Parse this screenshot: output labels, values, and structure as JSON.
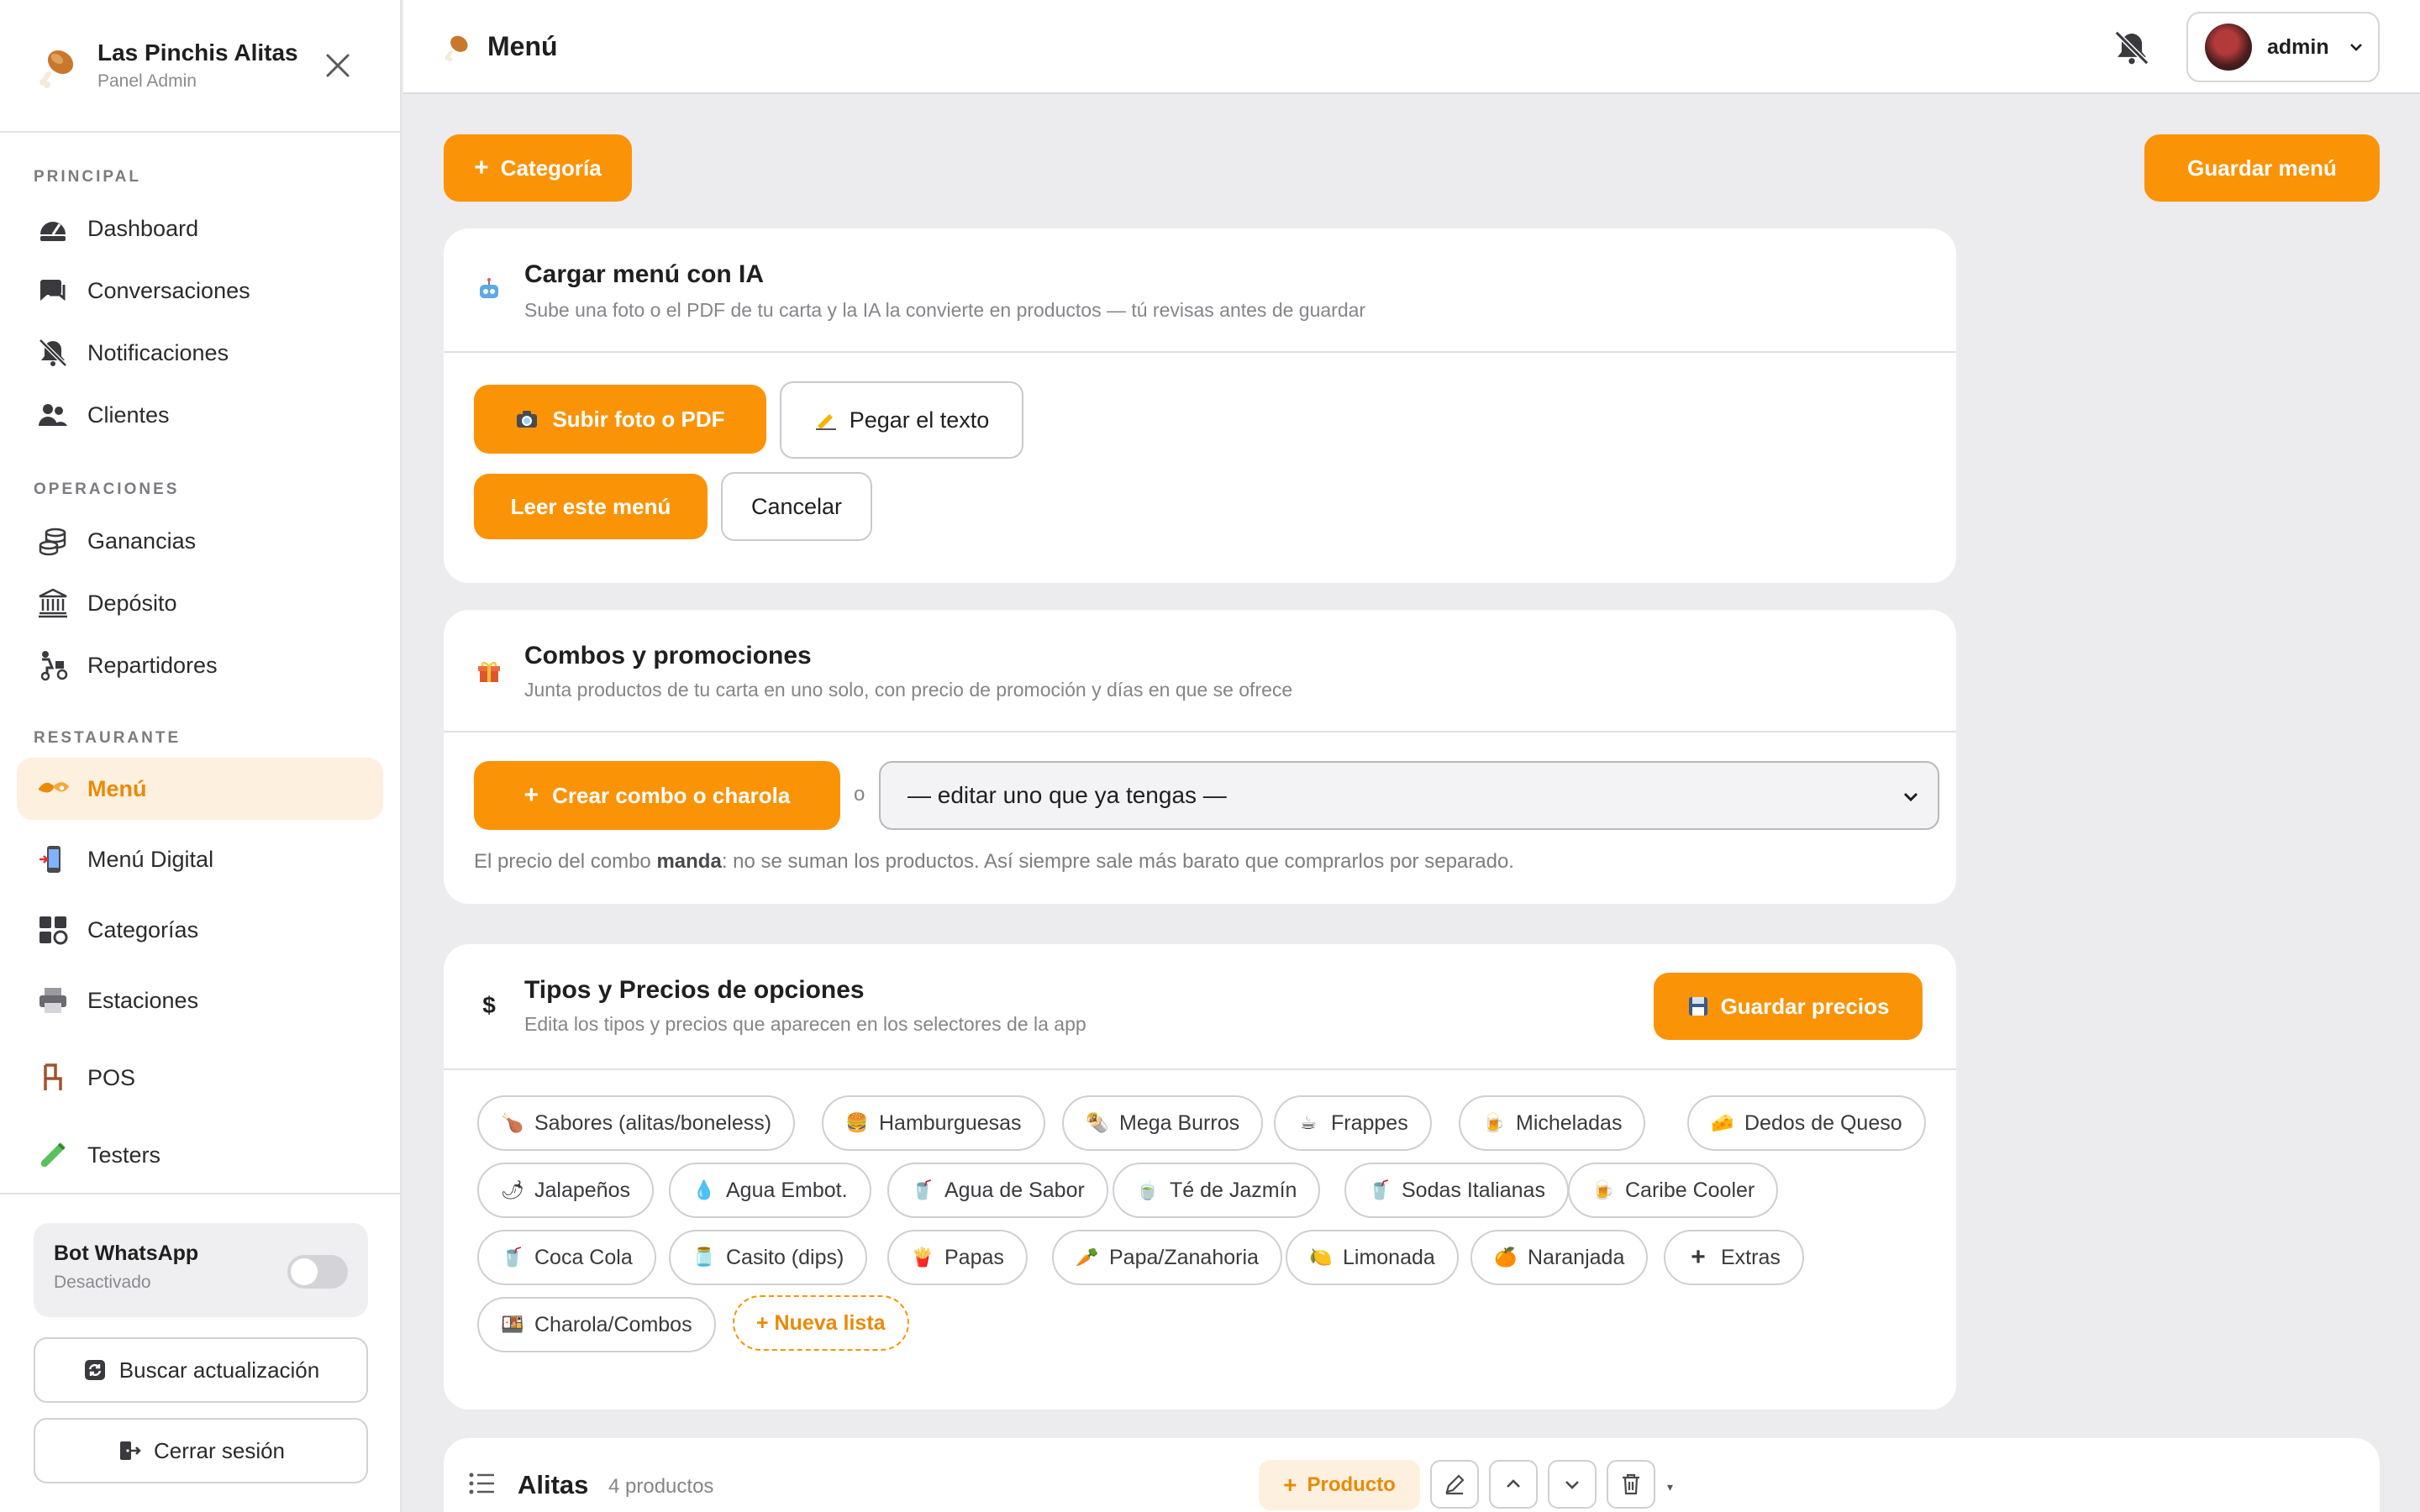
{
  "brand": {
    "title": "Las Pinchis Alitas",
    "subtitle": "Panel Admin",
    "icon": "drumstick-icon"
  },
  "sidebar": {
    "sections": [
      {
        "label": "PRINCIPAL",
        "items": [
          {
            "label": "Dashboard",
            "icon": "dashboard-icon",
            "active": false
          },
          {
            "label": "Conversaciones",
            "icon": "chat-icon",
            "active": false
          },
          {
            "label": "Notificaciones",
            "icon": "bell-off-icon",
            "active": false
          },
          {
            "label": "Clientes",
            "icon": "users-icon",
            "active": false
          }
        ]
      },
      {
        "label": "OPERACIONES",
        "items": [
          {
            "label": "Ganancias",
            "icon": "coins-icon",
            "active": false
          },
          {
            "label": "Depósito",
            "icon": "bank-icon",
            "active": false
          },
          {
            "label": "Repartidores",
            "icon": "delivery-icon",
            "active": false
          }
        ]
      },
      {
        "label": "RESTAURANTE",
        "items": [
          {
            "label": "Menú",
            "icon": "wings-icon",
            "active": true
          },
          {
            "label": "Menú Digital",
            "icon": "phone-icon",
            "active": false
          },
          {
            "label": "Categorías",
            "icon": "grid-icon",
            "active": false
          },
          {
            "label": "Estaciones",
            "icon": "printer-icon",
            "active": false
          },
          {
            "label": "POS",
            "icon": "chair-icon",
            "active": false
          },
          {
            "label": "Testers",
            "icon": "test-tube-icon",
            "active": false
          }
        ]
      }
    ],
    "bot": {
      "title": "Bot WhatsApp",
      "status": "Desactivado",
      "enabled": false
    },
    "update_button": "Buscar actualización",
    "logout_button": "Cerrar sesión"
  },
  "topbar": {
    "title": "Menú",
    "title_icon": "drumstick-icon",
    "user_name": "admin"
  },
  "toolbar": {
    "add_category": "Categoría",
    "save_menu": "Guardar menú"
  },
  "ai_card": {
    "icon": "robot-icon",
    "title": "Cargar menú con IA",
    "subtitle": "Sube una foto o el PDF de tu carta y la IA la convierte en productos — tú revisas antes de guardar",
    "upload_button": "Subir foto o PDF",
    "paste_button": "Pegar el texto",
    "read_button": "Leer este menú",
    "cancel_button": "Cancelar"
  },
  "combos_card": {
    "icon": "gift-icon",
    "title": "Combos y promociones",
    "subtitle": "Junta productos de tu carta en uno solo, con precio de promoción y días en que se ofrece",
    "create_button": "Crear combo o charola",
    "or_text": "o",
    "select_value": "— editar uno que ya tengas —",
    "note_before": "El precio del combo ",
    "note_bold": "manda",
    "note_after": ": no se suman los productos. Así siempre sale más barato que comprarlos por separado."
  },
  "prices_card": {
    "icon": "dollar-icon",
    "title": "Tipos y Precios de opciones",
    "subtitle": "Edita los tipos y precios que aparecen en los selectores de la app",
    "save_button": "Guardar precios",
    "chips": [
      {
        "emoji": "🍗",
        "label": "Sabores (alitas/boneless)"
      },
      {
        "emoji": "🍔",
        "label": "Hamburguesas"
      },
      {
        "emoji": "🌯",
        "label": "Mega Burros"
      },
      {
        "emoji": "☕",
        "label": "Frappes"
      },
      {
        "emoji": "🍺",
        "label": "Micheladas"
      },
      {
        "emoji": "🧀",
        "label": "Dedos de Queso"
      },
      {
        "emoji": "🌶",
        "label": "Jalapeños"
      },
      {
        "emoji": "💧",
        "label": "Agua Embot."
      },
      {
        "emoji": "🥤",
        "label": "Agua de Sabor"
      },
      {
        "emoji": "🍵",
        "label": "Té de Jazmín"
      },
      {
        "emoji": "🥤",
        "label": "Sodas Italianas"
      },
      {
        "emoji": "🍺",
        "label": "Caribe Cooler"
      },
      {
        "emoji": "🥤",
        "label": "Coca Cola"
      },
      {
        "emoji": "🫙",
        "label": "Casito (dips)"
      },
      {
        "emoji": "🍟",
        "label": "Papas"
      },
      {
        "emoji": "🥕",
        "label": "Papa/Zanahoria"
      },
      {
        "emoji": "🍋",
        "label": "Limonada"
      },
      {
        "emoji": "🍊",
        "label": "Naranjada"
      },
      {
        "emoji": "+",
        "label": "Extras"
      },
      {
        "emoji": "🍱",
        "label": "Charola/Combos"
      }
    ],
    "new_list": "+ Nueva lista"
  },
  "category_section": {
    "title": "Alitas",
    "count": "4 productos",
    "add_product": "Producto"
  },
  "colors": {
    "accent": "#fb9307",
    "accent_text": "#e98a08",
    "active_bg": "#fdf0de",
    "background": "#ececee"
  }
}
